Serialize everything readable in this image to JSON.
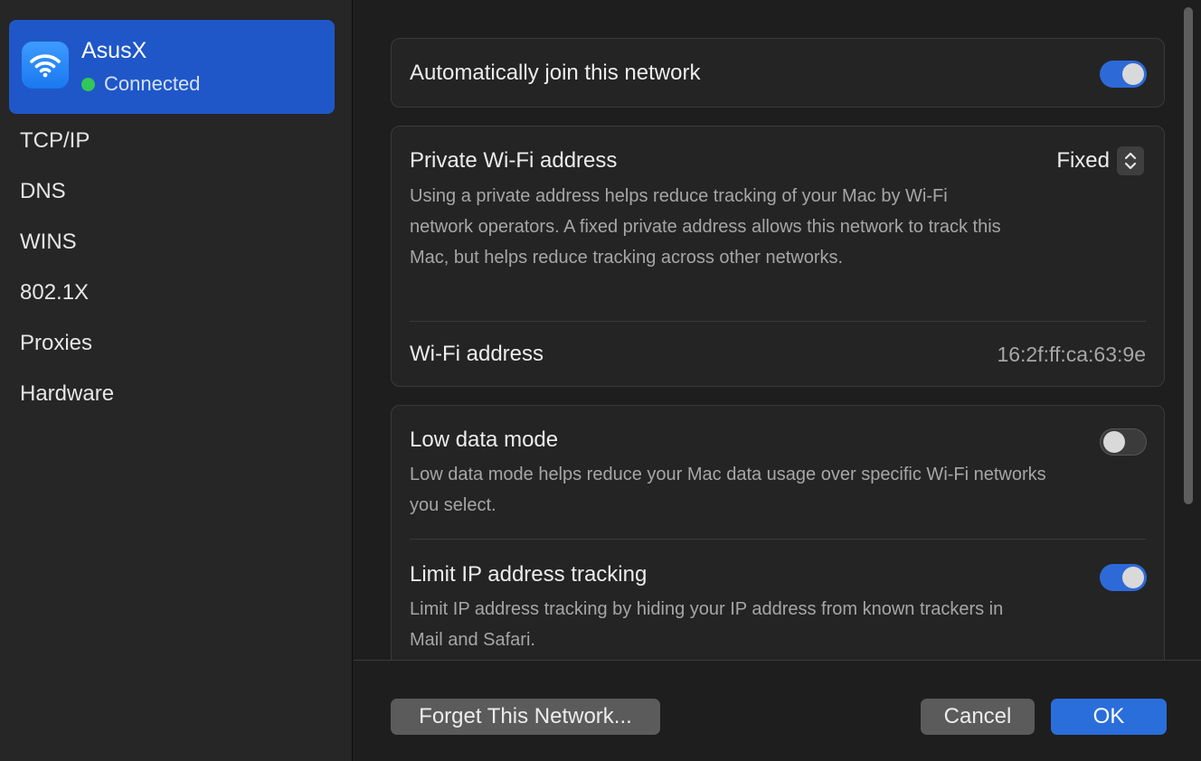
{
  "sidebar": {
    "network": {
      "name": "AsusX",
      "status": "Connected",
      "icon": "wifi-icon",
      "status_color": "#32c759"
    },
    "items": [
      {
        "label": "TCP/IP"
      },
      {
        "label": "DNS"
      },
      {
        "label": "WINS"
      },
      {
        "label": "802.1X"
      },
      {
        "label": "Proxies"
      },
      {
        "label": "Hardware"
      }
    ]
  },
  "settings": {
    "auto_join": {
      "label": "Automatically join this network",
      "enabled": true
    },
    "private_address": {
      "label": "Private Wi-Fi address",
      "value": "Fixed",
      "description": "Using a private address helps reduce tracking of your Mac by Wi-Fi network operators. A fixed private address allows this network to track this Mac, but helps reduce tracking across other networks."
    },
    "wifi_address": {
      "label": "Wi-Fi address",
      "value": "16:2f:ff:ca:63:9e"
    },
    "low_data_mode": {
      "label": "Low data mode",
      "description": "Low data mode helps reduce your Mac data usage over specific Wi-Fi networks you select.",
      "enabled": false
    },
    "limit_ip_tracking": {
      "label": "Limit IP address tracking",
      "description": "Limit IP address tracking by hiding your IP address from known trackers in Mail and Safari.",
      "enabled": true
    }
  },
  "footer": {
    "forget_label": "Forget This Network...",
    "cancel_label": "Cancel",
    "ok_label": "OK"
  },
  "colors": {
    "accent": "#2a6edb",
    "selected_sidebar": "#1f57c9"
  }
}
